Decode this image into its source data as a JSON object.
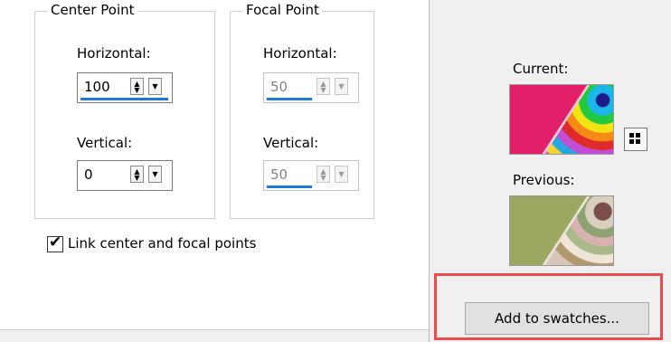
{
  "center_point": {
    "title": "Center Point",
    "horizontal": {
      "label": "Horizontal:",
      "value": "100"
    },
    "vertical": {
      "label": "Vertical:",
      "value": "0"
    }
  },
  "focal_point": {
    "title": "Focal Point",
    "horizontal": {
      "label": "Horizontal:",
      "value": "50"
    },
    "vertical": {
      "label": "Vertical:",
      "value": "50"
    }
  },
  "link_checkbox": {
    "label": "Link center and focal points",
    "checked": true
  },
  "colors": {
    "current_label": "Current:",
    "previous_label": "Previous:",
    "add_to_swatches_label": "Add to swatches...",
    "highlight_color": "#e84c4c"
  },
  "icons": {
    "spin_up": "▲",
    "spin_down": "▼",
    "checkmark": "✔"
  }
}
